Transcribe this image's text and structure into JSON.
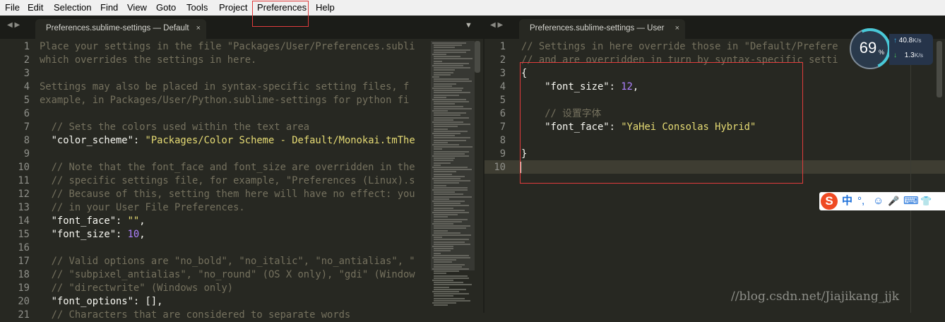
{
  "menu": {
    "items": [
      "File",
      "Edit",
      "Selection",
      "Find",
      "View",
      "Goto",
      "Tools",
      "Project",
      "Preferences",
      "Help"
    ]
  },
  "left_pane": {
    "tab_label": "Preferences.sublime-settings — Default",
    "close_glyph": "×",
    "nav_glyph": "◀ ▶",
    "overflow_glyph": "▼",
    "line_numbers": [
      "1",
      "2",
      "3",
      "4",
      "5",
      "6",
      "7",
      "8",
      "9",
      "10",
      "11",
      "12",
      "13",
      "14",
      "15",
      "16",
      "17",
      "18",
      "19",
      "20",
      "21"
    ],
    "lines": [
      [
        {
          "t": "Place your settings in the file \"Packages/User/Preferences.subli",
          "c": "c-com"
        }
      ],
      [
        {
          "t": "which overrides the settings in here.",
          "c": "c-com"
        }
      ],
      [],
      [
        {
          "t": "Settings may also be placed in syntax-specific setting files, f",
          "c": "c-com"
        }
      ],
      [
        {
          "t": "example, in Packages/User/Python.sublime-settings for python fi",
          "c": "c-com"
        }
      ],
      [],
      [
        {
          "t": "  // Sets the colors used within the text area",
          "c": "c-com"
        }
      ],
      [
        {
          "t": "  ",
          "c": "c-plain"
        },
        {
          "t": "\"color_scheme\"",
          "c": "c-plain"
        },
        {
          "t": ": ",
          "c": "c-plain"
        },
        {
          "t": "\"Packages/Color Scheme - Default/Monokai.tmThe",
          "c": "c-str"
        }
      ],
      [],
      [
        {
          "t": "  // Note that the font_face and font_size are overridden in the",
          "c": "c-com"
        }
      ],
      [
        {
          "t": "  // specific settings file, for example, \"Preferences (Linux).s",
          "c": "c-com"
        }
      ],
      [
        {
          "t": "  // Because of this, setting them here will have no effect: you",
          "c": "c-com"
        }
      ],
      [
        {
          "t": "  // in your User File Preferences.",
          "c": "c-com"
        }
      ],
      [
        {
          "t": "  ",
          "c": "c-plain"
        },
        {
          "t": "\"font_face\"",
          "c": "c-plain"
        },
        {
          "t": ": ",
          "c": "c-plain"
        },
        {
          "t": "\"\"",
          "c": "c-str"
        },
        {
          "t": ",",
          "c": "c-plain"
        }
      ],
      [
        {
          "t": "  ",
          "c": "c-plain"
        },
        {
          "t": "\"font_size\"",
          "c": "c-plain"
        },
        {
          "t": ": ",
          "c": "c-plain"
        },
        {
          "t": "10",
          "c": "c-num"
        },
        {
          "t": ",",
          "c": "c-plain"
        }
      ],
      [],
      [
        {
          "t": "  // Valid options are \"no_bold\", \"no_italic\", \"no_antialias\", \"",
          "c": "c-com"
        }
      ],
      [
        {
          "t": "  // \"subpixel_antialias\", \"no_round\" (OS X only), \"gdi\" (Window",
          "c": "c-com"
        }
      ],
      [
        {
          "t": "  // \"directwrite\" (Windows only)",
          "c": "c-com"
        }
      ],
      [
        {
          "t": "  ",
          "c": "c-plain"
        },
        {
          "t": "\"font_options\"",
          "c": "c-plain"
        },
        {
          "t": ": [],",
          "c": "c-plain"
        }
      ],
      [
        {
          "t": "  // Characters that are considered to separate words",
          "c": "c-com"
        }
      ]
    ]
  },
  "right_pane": {
    "tab_label": "Preferences.sublime-settings — User",
    "close_glyph": "×",
    "nav_glyph": "◀ ▶",
    "line_numbers": [
      "1",
      "2",
      "3",
      "4",
      "5",
      "6",
      "7",
      "8",
      "9",
      "10"
    ],
    "lines": [
      [
        {
          "t": "// Settings in here override those in \"Default/Prefere",
          "c": "c-com"
        }
      ],
      [
        {
          "t": "// and are overridden in turn by syntax-specific setti",
          "c": "c-com"
        }
      ],
      [
        {
          "t": "{",
          "c": "c-plain"
        }
      ],
      [
        {
          "t": "    ",
          "c": "c-plain"
        },
        {
          "t": "\"font_size\"",
          "c": "c-plain"
        },
        {
          "t": ": ",
          "c": "c-plain"
        },
        {
          "t": "12",
          "c": "c-num"
        },
        {
          "t": ",",
          "c": "c-plain"
        }
      ],
      [],
      [
        {
          "t": "    // 设置字体",
          "c": "c-com"
        }
      ],
      [
        {
          "t": "    ",
          "c": "c-plain"
        },
        {
          "t": "\"font_face\"",
          "c": "c-plain"
        },
        {
          "t": ": ",
          "c": "c-plain"
        },
        {
          "t": "\"YaHei Consolas Hybrid\"",
          "c": "c-str"
        }
      ],
      [],
      [
        {
          "t": "}",
          "c": "c-plain"
        }
      ],
      []
    ]
  },
  "speed_widget": {
    "percent": "69",
    "percent_sign": "%",
    "upload_speed": "40.8",
    "upload_unit": "K/s",
    "download_speed": "1.3",
    "download_unit": "K/s",
    "up_arrow": "↑",
    "down_arrow": "↓"
  },
  "ime_toolbar": {
    "logo": "S",
    "icons": [
      "中",
      "°,",
      "☺",
      "🎤",
      "⌨",
      "👕"
    ]
  },
  "watermark": "//blog.csdn.net/Jiajikang_jjk",
  "colors": {
    "background": "#272822",
    "comment": "#75715e",
    "string": "#e6db74",
    "number": "#ae81ff",
    "highlight_box": "#e03c3c"
  }
}
